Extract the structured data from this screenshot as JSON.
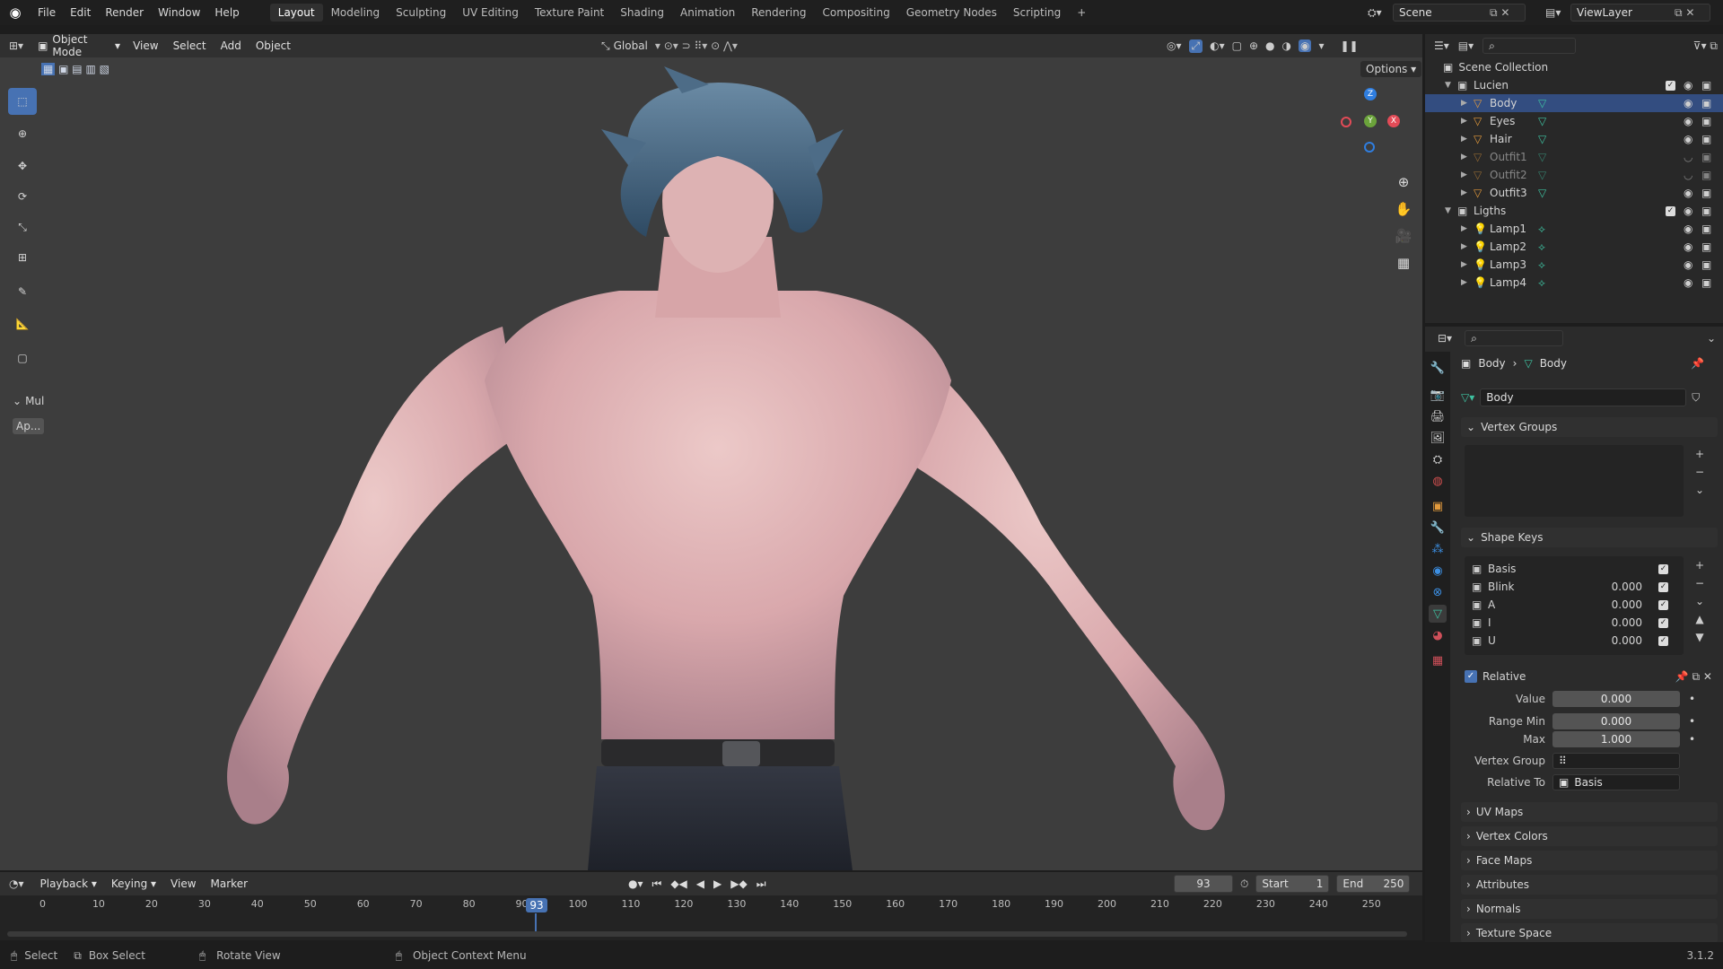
{
  "topbar": {
    "menus": [
      "File",
      "Edit",
      "Render",
      "Window",
      "Help"
    ],
    "workspaces": [
      "Layout",
      "Modeling",
      "Sculpting",
      "UV Editing",
      "Texture Paint",
      "Shading",
      "Animation",
      "Rendering",
      "Compositing",
      "Geometry Nodes",
      "Scripting"
    ],
    "active_workspace": "Layout",
    "add_tab": "+",
    "scene": "Scene",
    "view_layer": "ViewLayer"
  },
  "viewport_header": {
    "mode": "Object Mode",
    "menus": [
      "View",
      "Select",
      "Add",
      "Object"
    ],
    "transform": "Global",
    "options": "Options"
  },
  "toolbar": {
    "panel_label": "Mul",
    "panel_button": "Ap..."
  },
  "gizmo": {
    "z": "Z",
    "x": "X",
    "y": "Y"
  },
  "outliner": {
    "root": "Scene Collection",
    "items": [
      {
        "name": "Lucien",
        "type": "collection",
        "level": 1,
        "expanded": true
      },
      {
        "name": "Body",
        "type": "mesh",
        "level": 2,
        "selected": true
      },
      {
        "name": "Eyes",
        "type": "mesh",
        "level": 2
      },
      {
        "name": "Hair",
        "type": "mesh",
        "level": 2
      },
      {
        "name": "Outfit1",
        "type": "mesh",
        "level": 2,
        "hidden": true
      },
      {
        "name": "Outfit2",
        "type": "mesh",
        "level": 2,
        "hidden": true
      },
      {
        "name": "Outfit3",
        "type": "mesh",
        "level": 2
      },
      {
        "name": "Ligths",
        "type": "collection",
        "level": 1,
        "expanded": true
      },
      {
        "name": "Lamp1",
        "type": "light",
        "level": 2
      },
      {
        "name": "Lamp2",
        "type": "light",
        "level": 2
      },
      {
        "name": "Lamp3",
        "type": "light",
        "level": 2
      },
      {
        "name": "Lamp4",
        "type": "light",
        "level": 2
      }
    ]
  },
  "properties": {
    "breadcrumb_object": "Body",
    "breadcrumb_data": "Body",
    "data_name": "Body",
    "vertex_groups": "Vertex Groups",
    "shape_keys_title": "Shape Keys",
    "shape_keys": [
      {
        "name": "Basis",
        "value": ""
      },
      {
        "name": "Blink",
        "value": "0.000"
      },
      {
        "name": "A",
        "value": "0.000"
      },
      {
        "name": "I",
        "value": "0.000"
      },
      {
        "name": "U",
        "value": "0.000"
      }
    ],
    "relative": "Relative",
    "value_label": "Value",
    "value": "0.000",
    "range_min_label": "Range Min",
    "range_min": "0.000",
    "max_label": "Max",
    "max": "1.000",
    "vertex_group_label": "Vertex Group",
    "relative_to_label": "Relative To",
    "relative_to": "Basis",
    "collapsed_panels": [
      "UV Maps",
      "Vertex Colors",
      "Face Maps",
      "Attributes",
      "Normals",
      "Texture Space"
    ]
  },
  "timeline": {
    "menus": [
      "Playback",
      "Keying",
      "View",
      "Marker"
    ],
    "current_frame": "93",
    "start_label": "Start",
    "start": "1",
    "end_label": "End",
    "end": "250",
    "ticks": [
      "0",
      "10",
      "20",
      "30",
      "40",
      "50",
      "60",
      "70",
      "80",
      "90",
      "100",
      "110",
      "120",
      "130",
      "140",
      "150",
      "160",
      "170",
      "180",
      "190",
      "200",
      "210",
      "220",
      "230",
      "240",
      "250"
    ]
  },
  "statusbar": {
    "select": "Select",
    "box_select": "Box Select",
    "rotate_view": "Rotate View",
    "context_menu": "Object Context Menu",
    "version": "3.1.2"
  },
  "colors": {
    "accent": "#4772b3",
    "selected_row": "#334d80",
    "mesh_icon": "#e39a3c",
    "data_icon": "#3ec2a1"
  }
}
